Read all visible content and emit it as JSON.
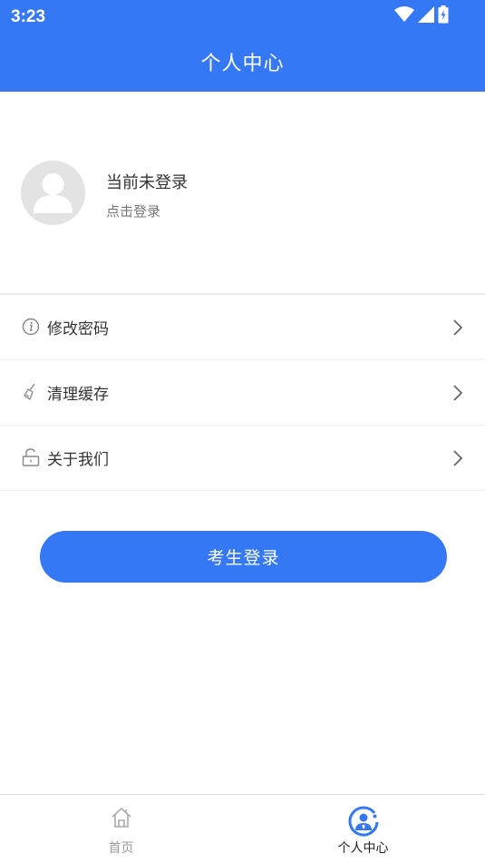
{
  "status_bar": {
    "time": "3:23"
  },
  "header": {
    "title": "个人中心"
  },
  "profile": {
    "status": "当前未登录",
    "hint": "点击登录",
    "avatar_icon": "user-placeholder-icon"
  },
  "menu": {
    "items": [
      {
        "label": "修改密码",
        "icon": "info-icon"
      },
      {
        "label": "清理缓存",
        "icon": "broom-icon"
      },
      {
        "label": "关于我们",
        "icon": "unlock-icon"
      }
    ]
  },
  "login_button": {
    "label": "考生登录"
  },
  "bottom_nav": {
    "items": [
      {
        "label": "首页",
        "icon": "home-icon",
        "active": false
      },
      {
        "label": "个人中心",
        "icon": "profile-center-icon",
        "active": true
      }
    ]
  },
  "colors": {
    "primary": "#3478f6",
    "text": "#333333",
    "muted": "#777777",
    "inactive": "#9a9a9a"
  }
}
